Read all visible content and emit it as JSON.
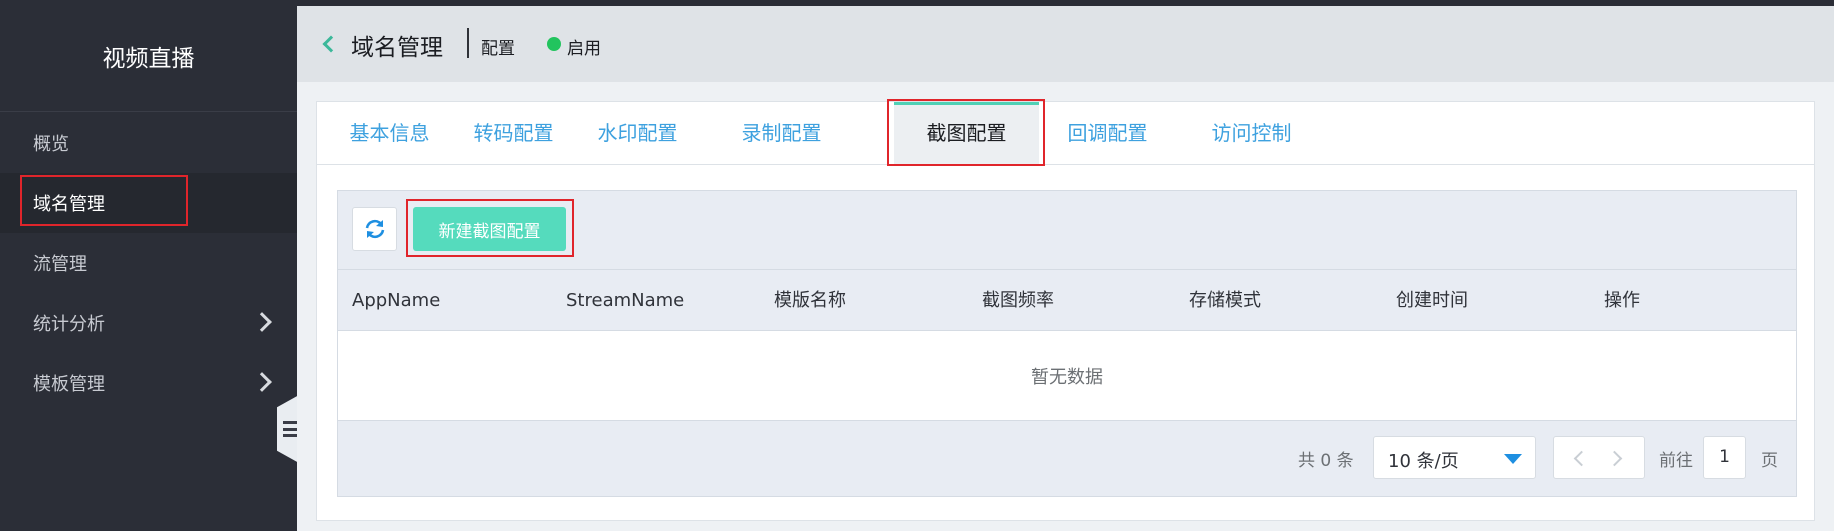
{
  "sidebar": {
    "title": "视频直播",
    "items": [
      {
        "label": "概览"
      },
      {
        "label": "域名管理"
      },
      {
        "label": "流管理"
      },
      {
        "label": "统计分析"
      },
      {
        "label": "模板管理"
      }
    ]
  },
  "topbar": {
    "title": "域名管理",
    "section": "配置",
    "status": "启用",
    "status_color": "#22c45e"
  },
  "tabs": [
    {
      "label": "基本信息"
    },
    {
      "label": "转码配置"
    },
    {
      "label": "水印配置"
    },
    {
      "label": "录制配置"
    },
    {
      "label": "截图配置"
    },
    {
      "label": "回调配置"
    },
    {
      "label": "访问控制"
    }
  ],
  "toolbar": {
    "refresh_icon": "refresh-icon",
    "new_button_label": "新建截图配置"
  },
  "table": {
    "columns": [
      "AppName",
      "StreamName",
      "模版名称",
      "截图频率",
      "存储模式",
      "创建时间",
      "操作"
    ],
    "empty_text": "暂无数据"
  },
  "pagination": {
    "total_label": "共 0 条",
    "page_size": "10 条/页",
    "goto_label": "前往",
    "current_page": "1",
    "page_suffix": "页"
  },
  "colors": {
    "accent_green": "#55dbbd",
    "tab_link": "#3ea1df",
    "highlight_red": "#e0252b"
  }
}
